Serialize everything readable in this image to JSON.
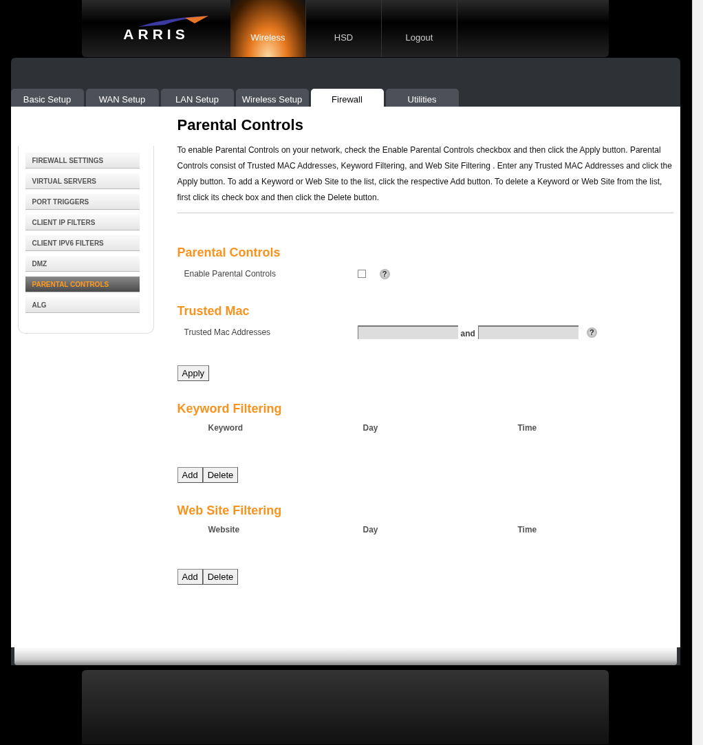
{
  "logo": {
    "text": "ARRIS"
  },
  "top_nav": [
    {
      "label": "Wireless",
      "selected": true
    },
    {
      "label": "HSD",
      "selected": false
    },
    {
      "label": "Logout",
      "selected": false
    }
  ],
  "tabs": [
    {
      "label": "Basic Setup",
      "selected": false
    },
    {
      "label": "WAN Setup",
      "selected": false
    },
    {
      "label": "LAN Setup",
      "selected": false
    },
    {
      "label": "Wireless Setup",
      "selected": false
    },
    {
      "label": "Firewall",
      "selected": true
    },
    {
      "label": "Utilities",
      "selected": false
    }
  ],
  "sidebar": {
    "items": [
      {
        "label": "FIREWALL SETTINGS",
        "selected": false
      },
      {
        "label": "VIRTUAL SERVERS",
        "selected": false
      },
      {
        "label": "PORT TRIGGERS",
        "selected": false
      },
      {
        "label": "CLIENT IP FILTERS",
        "selected": false
      },
      {
        "label": "CLIENT IPV6 FILTERS",
        "selected": false
      },
      {
        "label": "DMZ",
        "selected": false
      },
      {
        "label": "PARENTAL CONTROLS",
        "selected": true
      },
      {
        "label": "ALG",
        "selected": false
      }
    ]
  },
  "page": {
    "title": "Parental Controls",
    "description": "To enable Parental Controls on your network, check the Enable Parental Controls checkbox and then click the Apply button. Parental Controls consist of Trusted MAC Addresses, Keyword Filtering, and Web Site Filtering . Enter any Trusted MAC Addresses and click the Apply button. To add a Keyword or Web Site to the list, click the respective Add button. To delete a Keyword or Web Site from the list, first click its check box and then click the Delete button."
  },
  "parental_controls": {
    "heading": "Parental Controls",
    "label": "Enable Parental Controls",
    "checked": false,
    "help": "?"
  },
  "trusted_mac": {
    "heading": "Trusted Mac",
    "label": "Trusted Mac Addresses",
    "joiner": "and",
    "help": "?",
    "apply": "Apply"
  },
  "keyword_filtering": {
    "heading": "Keyword Filtering",
    "columns": [
      "Keyword",
      "Day",
      "Time"
    ],
    "buttons": [
      "Add",
      "Delete"
    ]
  },
  "website_filtering": {
    "heading": "Web Site Filtering",
    "columns": [
      "Website",
      "Day",
      "Time"
    ],
    "buttons": [
      "Add",
      "Delete"
    ]
  }
}
